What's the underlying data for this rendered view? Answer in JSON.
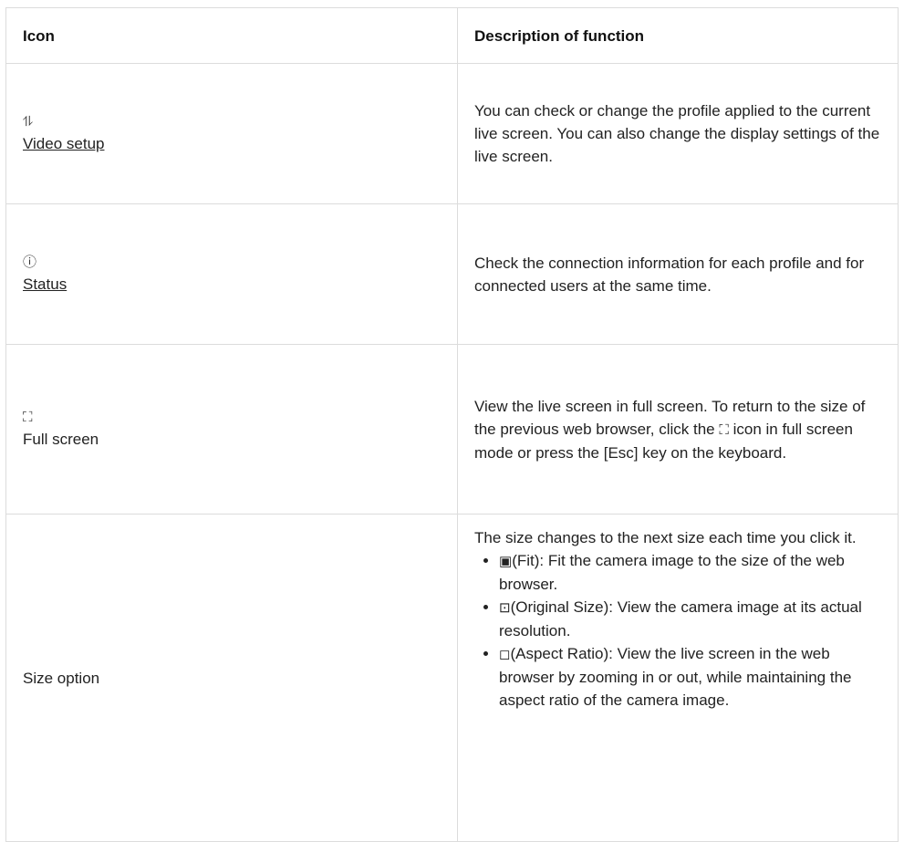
{
  "header": {
    "col1": "Icon",
    "col2": "Description of function"
  },
  "rows": [
    {
      "icon": "sliders-icon",
      "icon_glyph": "⥮",
      "name": "Video setup",
      "desc": "You can check or change the profile applied to the current live screen. You can also change the display settings of the live screen."
    },
    {
      "icon": "info-circle-icon",
      "icon_glyph": "ⓘ",
      "name": "Status",
      "desc": "Check the connection information for each profile and for connected users at the same time."
    },
    {
      "icon": "fullscreen-icon",
      "icon_glyph": "⛶",
      "name": "Full screen",
      "desc_before": "View the live screen in full screen. To return to the size of the previous web browser, click the ",
      "desc_icon": "⛶",
      "desc_after": " icon in full screen mode or press the [Esc] key on the keyboard."
    },
    {
      "name": "Size option",
      "desc_intro": "The size changes to the next size each time you click it.",
      "options": [
        {
          "icon": "fit-icon",
          "glyph": "▣",
          "label": "(Fit): Fit the camera image to the size of the web browser."
        },
        {
          "icon": "original-size-icon",
          "glyph": "⊡",
          "label": "(Original Size): View the camera image at its actual resolution."
        },
        {
          "icon": "aspect-ratio-icon",
          "glyph": "◻",
          "label": "(Aspect Ratio): View the live screen in the web browser by zooming in or out, while maintaining the aspect ratio of the camera image."
        }
      ]
    }
  ]
}
